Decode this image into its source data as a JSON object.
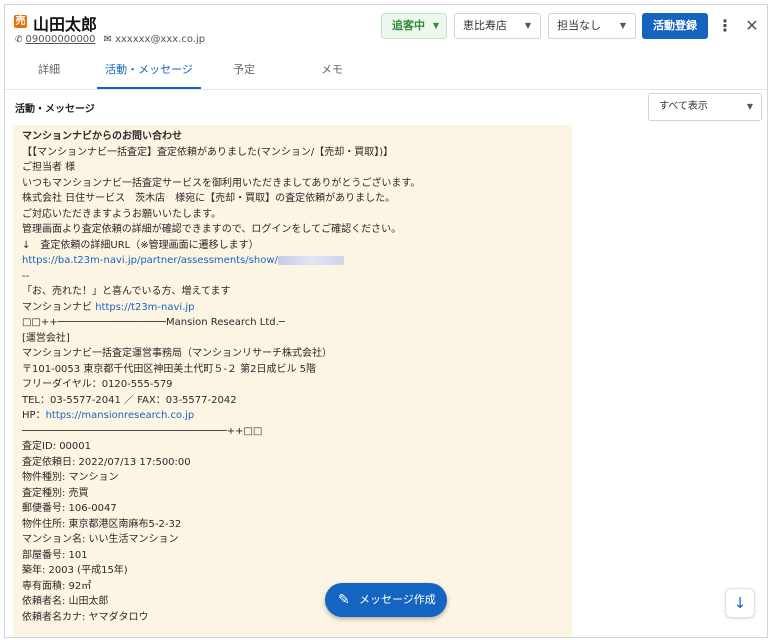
{
  "header": {
    "badge": "売",
    "name": "山田太郎",
    "phone": "09000000000",
    "email": "xxxxxx@xxx.co.jp",
    "status_label": "追客中",
    "store_label": "恵比寿店",
    "staff_label": "担当なし",
    "register_label": "活動登録"
  },
  "tabs": [
    {
      "label": "詳細"
    },
    {
      "label": "活動・メッセージ"
    },
    {
      "label": "予定"
    },
    {
      "label": "メモ"
    }
  ],
  "section": {
    "title": "活動・メッセージ",
    "filter_label": "すべて表示"
  },
  "message": {
    "lines": [
      "マンションナビからのお問い合わせ",
      "【【マンションナビ一括査定】査定依頼がありました(マンション/【売却・買取】)】",
      "",
      "ご担当者 様",
      "いつもマンションナビ一括査定サービスを御利用いただきましてありがとうございます。",
      "株式会社 日住サービス　茨木店　様宛に【売却・買取】の査定依頼がありました。",
      "ご対応いただきますようお願いいたします。",
      "管理画面より査定依頼の詳細が確認できますので、ログインをしてご確認ください。",
      "↓　査定依頼の詳細URL（※管理画面に遷移します）",
      "https://ba.t23m-navi.jp/partner/assessments/show/",
      "--",
      "「お、売れた！」と喜んでいる方、増えてます",
      "マンションナビ ",
      "□□++──────────────────Mansion Research Ltd.─",
      "[運営会社]",
      "マンションナビ一括査定運営事務局（マンションリサーチ株式会社）",
      "〒101-0053 東京都千代田区神田美土代町５-２ 第2日成ビル 5階",
      "フリーダイヤル：0120-555-579",
      "TEL：03-5577-2041 ／ FAX：03-5577-2042",
      "HP：",
      "──────────────────────────────────++□□",
      "査定ID: 00001",
      "査定依頼日: 2022/07/13 17:500:00",
      "物件種別: マンション",
      "査定種別: 売買",
      "郵便番号: 106-0047",
      "物件住所: 東京都港区南麻布5-2-32",
      "マンション名: いい生活マンション",
      "部屋番号: 101",
      "築年: 2003 (平成15年)",
      "専有面積: 92㎡",
      "依頼者名: 山田太郎",
      "依頼者名カナ: ヤマダタロウ"
    ],
    "links": {
      "line_12": "https://t23m-navi.jp",
      "line_19": "https://mansionresearch.co.jp"
    }
  },
  "fab": {
    "label": "メッセージ作成"
  },
  "icons": {
    "phone": "phone-icon",
    "mail": "mail-icon",
    "more": "more-vert-icon",
    "close": "close-icon",
    "compose": "pencil-icon",
    "scroll": "arrow-down-icon"
  },
  "colors": {
    "accent": "#1565c0",
    "status_green": "#2e8b3a",
    "message_bg": "#fdf5e4",
    "badge": "#e8710a"
  }
}
